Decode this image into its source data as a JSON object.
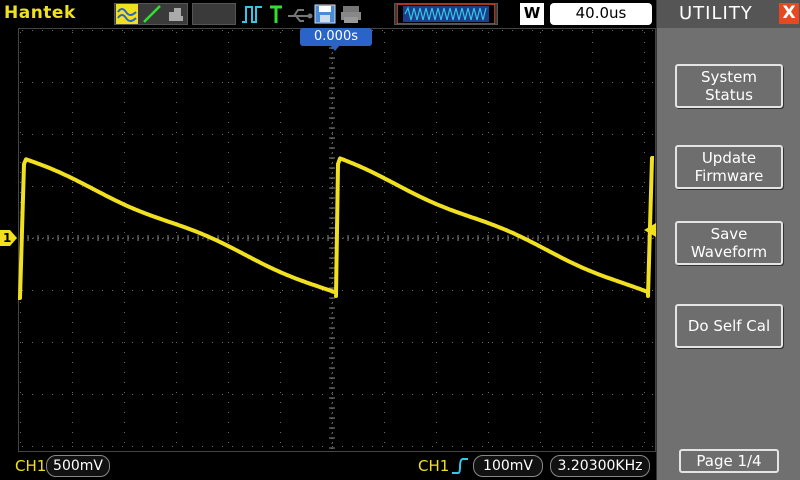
{
  "topbar": {
    "brand": "Hantek",
    "timebase_mode": "W",
    "timebase": "40.0us",
    "icons": [
      "waveform-icon",
      "slope-icon",
      "pattern-icon",
      "run-pulse-icon",
      "trigger-icon",
      "usb-icon",
      "save-icon",
      "print-icon",
      "memory-waveform-icon"
    ]
  },
  "screen": {
    "time_offset": "0.000s",
    "channel_marker": "1",
    "trace_color": "#f0e020"
  },
  "side": {
    "title": "UTILITY",
    "close_glyph": "X",
    "buttons": [
      {
        "line1": "System",
        "line2": "Status"
      },
      {
        "line1": "Update",
        "line2": "Firmware"
      },
      {
        "line1": "Save",
        "line2": "Waveform"
      },
      {
        "line1": "Do Self Cal",
        "line2": ""
      }
    ],
    "page": "Page 1/4"
  },
  "bottombar": {
    "ch1_label": "CH1",
    "ch1_scale": "500mV",
    "trigger_source": "CH1",
    "trigger_level": "100mV",
    "frequency": "3.20300KHz"
  }
}
